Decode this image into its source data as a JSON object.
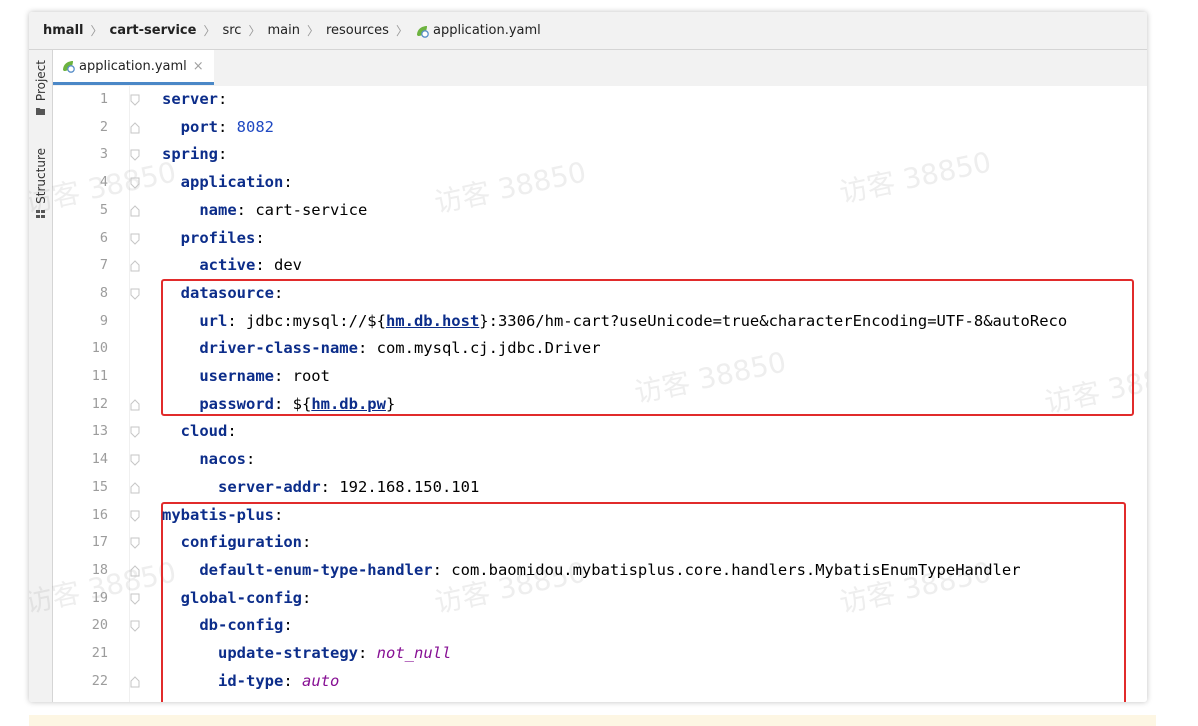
{
  "breadcrumb": [
    "hmall",
    "cart-service",
    "src",
    "main",
    "resources",
    "application.yaml"
  ],
  "sidebar": {
    "project_label": "Project",
    "structure_label": "Structure"
  },
  "tab": {
    "label": "application.yaml",
    "close": "×"
  },
  "watermark": "访客 38850",
  "code_lines": [
    {
      "num": "1",
      "html": "<span class=\"k\">server</span>:"
    },
    {
      "num": "2",
      "html": "  <span class=\"k\">port</span>: <span class=\"n\">8082</span>"
    },
    {
      "num": "3",
      "html": "<span class=\"k\">spring</span>:"
    },
    {
      "num": "4",
      "html": "  <span class=\"k\">application</span>:"
    },
    {
      "num": "5",
      "html": "    <span class=\"k\">name</span>: cart-service"
    },
    {
      "num": "6",
      "html": "  <span class=\"k\">profiles</span>:"
    },
    {
      "num": "7",
      "html": "    <span class=\"k\">active</span>: dev"
    },
    {
      "num": "8",
      "html": "  <span class=\"k\">datasource</span>:"
    },
    {
      "num": "9",
      "html": "    <span class=\"k\">url</span>: jdbc:mysql://${<span class=\"u\">hm.db.host</span>}:3306/hm-cart?useUnicode=true&amp;characterEncoding=UTF-8&amp;autoReco"
    },
    {
      "num": "10",
      "html": "    <span class=\"k\">driver-class-name</span>: com.mysql.cj.jdbc.Driver"
    },
    {
      "num": "11",
      "html": "    <span class=\"k\">username</span>: root"
    },
    {
      "num": "12",
      "html": "    <span class=\"k\">password</span>: ${<span class=\"u\">hm.db.pw</span>}"
    },
    {
      "num": "13",
      "html": "  <span class=\"k\">cloud</span>:"
    },
    {
      "num": "14",
      "html": "    <span class=\"k\">nacos</span>:"
    },
    {
      "num": "15",
      "html": "      <span class=\"k\">server-addr</span>: 192.168.150.101"
    },
    {
      "num": "16",
      "html": "<span class=\"k\">mybatis-plus</span>:"
    },
    {
      "num": "17",
      "html": "  <span class=\"k\">configuration</span>:"
    },
    {
      "num": "18",
      "html": "    <span class=\"k\">default-enum-type-handler</span>: com.baomidou.mybatisplus.core.handlers.MybatisEnumTypeHandler"
    },
    {
      "num": "19",
      "html": "  <span class=\"k\">global-config</span>:"
    },
    {
      "num": "20",
      "html": "    <span class=\"k\">db-config</span>:"
    },
    {
      "num": "21",
      "html": "      <span class=\"k\">update-strategy</span>: <span class=\"it\">not_null</span>"
    },
    {
      "num": "22",
      "html": "      <span class=\"k\">id-type</span>: <span class=\"it\">auto</span>"
    }
  ],
  "colors": {
    "key": "#0c2d8a",
    "number": "#1f49c2",
    "enum_value": "#871094",
    "highlight_box": "#e12b2b",
    "tab_underline": "#4b88c7"
  }
}
